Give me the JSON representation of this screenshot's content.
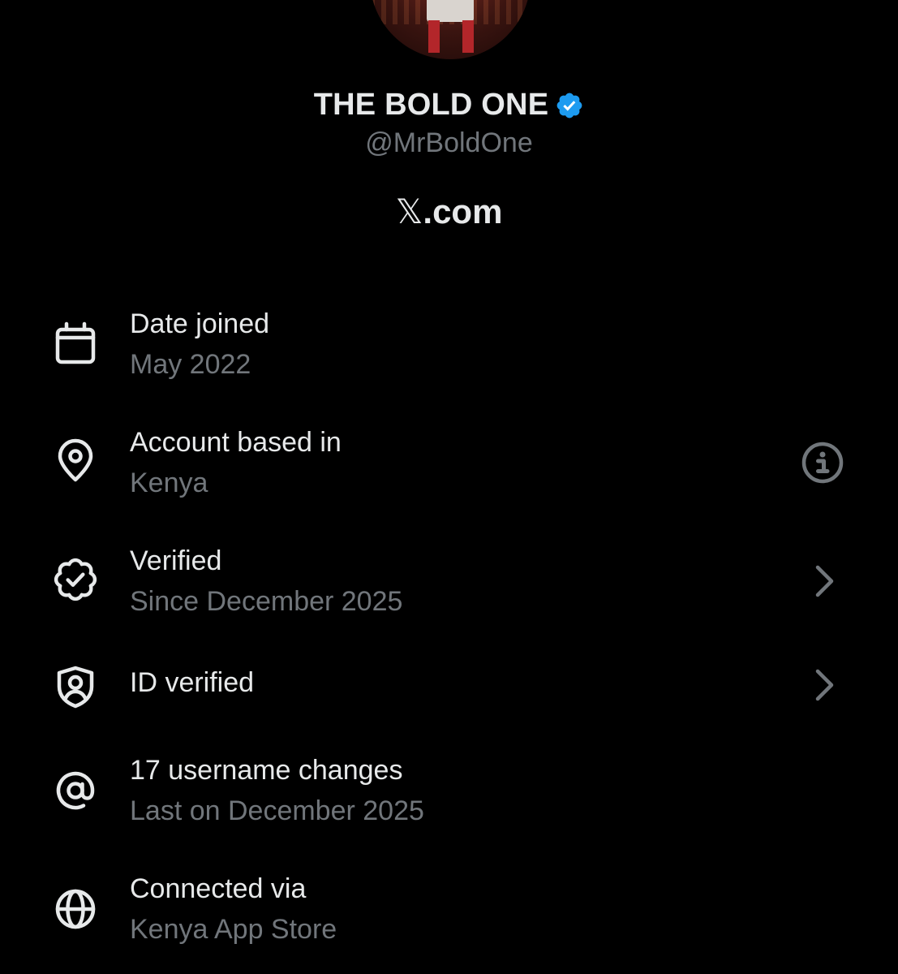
{
  "profile": {
    "display_name": "THE BOLD ONE",
    "handle": "@MrBoldOne",
    "site_x": "𝕏",
    "site_domain": ".com",
    "verified_badge_color": "#1d9bf0"
  },
  "info_rows": [
    {
      "icon": "calendar-icon",
      "title": "Date joined",
      "subtitle": "May 2022"
    },
    {
      "icon": "location-pin-icon",
      "title": "Account based in",
      "subtitle": "Kenya",
      "action_icon": "info-icon"
    },
    {
      "icon": "verified-badge-icon",
      "title": "Verified",
      "subtitle": "Since December 2025",
      "action_icon": "chevron-right-icon"
    },
    {
      "icon": "shield-user-icon",
      "title": "ID verified",
      "action_icon": "chevron-right-icon"
    },
    {
      "icon": "at-sign-icon",
      "title": "17 username changes",
      "subtitle": "Last on December 2025"
    },
    {
      "icon": "globe-icon",
      "title": "Connected via",
      "subtitle": "Kenya App Store"
    }
  ],
  "colors": {
    "background": "#000000",
    "primary_text": "#e7e9ea",
    "secondary_text": "#71767b",
    "accent": "#1d9bf0"
  }
}
